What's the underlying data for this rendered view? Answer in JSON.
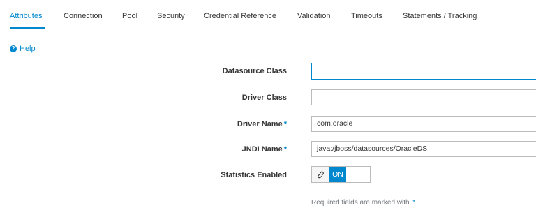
{
  "tabs": [
    {
      "label": "Attributes",
      "active": true
    },
    {
      "label": "Connection",
      "active": false
    },
    {
      "label": "Pool",
      "active": false
    },
    {
      "label": "Security",
      "active": false
    },
    {
      "label": "Credential Reference",
      "active": false
    },
    {
      "label": "Validation",
      "active": false
    },
    {
      "label": "Timeouts",
      "active": false
    },
    {
      "label": "Statements / Tracking",
      "active": false
    }
  ],
  "help": {
    "icon": "question-circle-icon",
    "label": "Help"
  },
  "form": {
    "datasource_class": {
      "label": "Datasource Class",
      "value": "",
      "required": false
    },
    "driver_class": {
      "label": "Driver Class",
      "value": "",
      "required": false
    },
    "driver_name": {
      "label": "Driver Name",
      "value": "com.oracle",
      "required": true
    },
    "jndi_name": {
      "label": "JNDI Name",
      "value": "java:/jboss/datasources/OracleDS",
      "required": true
    },
    "statistics_enabled": {
      "label": "Statistics Enabled",
      "state_label": "ON",
      "value": true,
      "handle_icon": "link-icon"
    }
  },
  "required_marker": "*",
  "required_note": "Required fields are marked with",
  "colors": {
    "accent": "#0088ce",
    "text": "#363636",
    "muted": "#72767b",
    "border": "#bbbbbb"
  }
}
